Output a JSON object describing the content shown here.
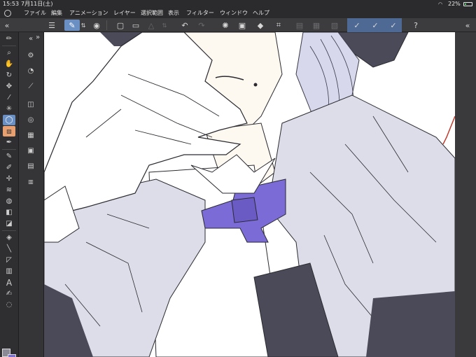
{
  "status": {
    "time": "15:53",
    "date": "7月11日(土)",
    "battery": "22%",
    "battery_level": 0.22
  },
  "menu": {
    "items": [
      "ファイル",
      "編集",
      "アニメーション",
      "レイヤー",
      "選択範囲",
      "表示",
      "フィルター",
      "ウィンドウ",
      "ヘルプ"
    ]
  },
  "toolbar": {
    "tool_names": [
      "brush-tool",
      "zoom-tool",
      "hand-tool",
      "rotate-tool",
      "move-tool",
      "eyedropper-tool",
      "auto-select-tool",
      "lasso-tool",
      "selection-tool",
      "pen-tool",
      "pencil-tool",
      "brush-tool-2",
      "airbrush-tool",
      "blend-tool",
      "decoration-tool",
      "fill-tool",
      "gradient-tool",
      "eraser-tool",
      "figure-tool",
      "line-tool",
      "ruler-tool",
      "frame-tool",
      "text-tool",
      "correction-tool",
      "balloon-tool"
    ],
    "text_tool_glyph": "A",
    "selected": "lasso-tool"
  },
  "colors": {
    "main": "#8a8a96",
    "sub": "#7a6fd0",
    "accent": "#6a8fc2",
    "bow": "#7b6bd6",
    "coat": "#dcdde8",
    "dark": "#4a4a58",
    "skin": "#fdf8f0",
    "hair": "#c9cbe2"
  }
}
